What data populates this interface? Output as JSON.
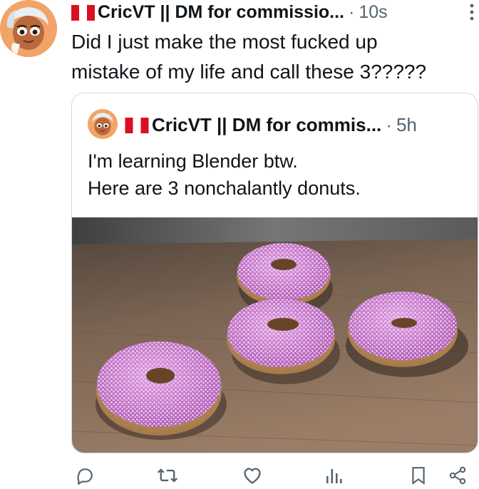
{
  "tweet": {
    "author_name": "CricVT || DM for commissio...",
    "separator": "·",
    "timestamp": "10s",
    "text_line1": "Did I just make the most fucked up",
    "text_line2": "mistake of my life and call these 3?????"
  },
  "quoted_tweet": {
    "author_name": "CricVT || DM for commis...",
    "separator": "·",
    "timestamp": "5h",
    "text_line1": "I'm learning Blender btw.",
    "text_line2": "Here are 3 nonchalantly donuts.",
    "image_subject": "3 pink frosted donuts with white sprinkles on a wooden table"
  },
  "actions": [
    "reply-icon",
    "retweet-icon",
    "like-icon",
    "views-icon",
    "bookmark-icon",
    "share-icon"
  ],
  "colors": {
    "text": "#0f1419",
    "muted": "#536471",
    "border": "#cfd9de",
    "flag_red": "#d91023",
    "frosting": "#c46fc9",
    "table_wood": "#7d6450"
  }
}
